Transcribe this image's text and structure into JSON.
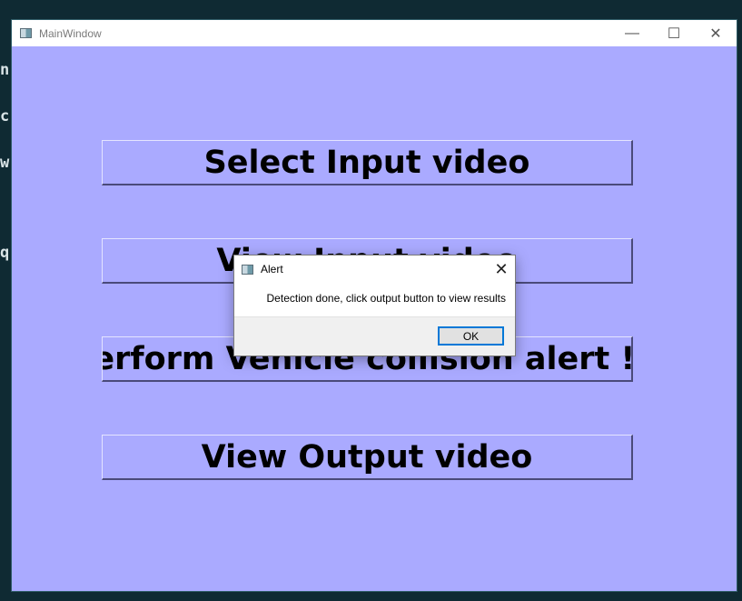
{
  "background_terminal": {
    "glyphs": [
      "n",
      "c",
      "w",
      "q"
    ]
  },
  "window": {
    "title": "MainWindow",
    "controls": {
      "minimize": "—",
      "maximize": "☐",
      "close": "✕"
    },
    "background_color": "#aaaaff"
  },
  "buttons": {
    "select_input": "Select Input video",
    "view_input": "View Input video",
    "perform_alert": "Perform Vehicle collision alert !!!",
    "view_output": "View Output video"
  },
  "dialog": {
    "title": "Alert",
    "close": "✕",
    "message": "Detection done, click output button to view results",
    "ok_label": "OK",
    "accent_color": "#0078d7"
  }
}
